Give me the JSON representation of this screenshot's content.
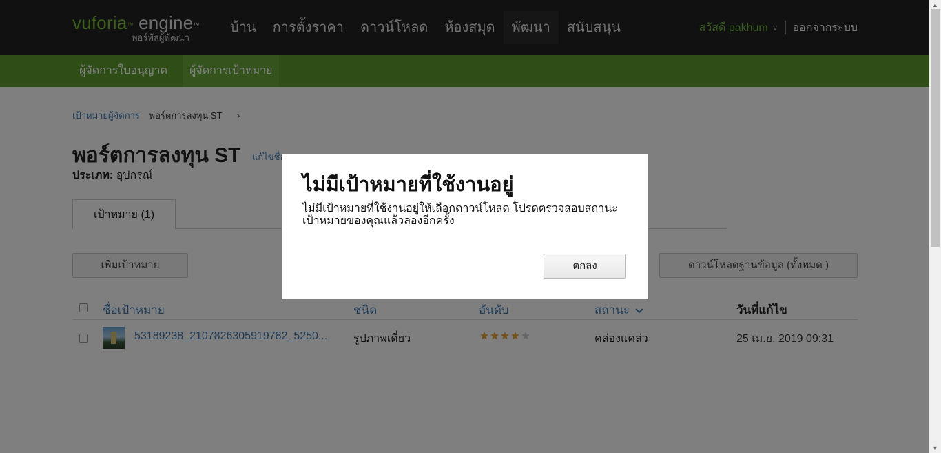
{
  "header": {
    "logo": {
      "brand": "vuforia",
      "product": "engine",
      "tm": "™",
      "subtitle": "พอร์ทัลผู้พัฒนา"
    },
    "nav": [
      {
        "label": "บ้าน"
      },
      {
        "label": "การตั้งราคา"
      },
      {
        "label": "ดาวน์โหลด"
      },
      {
        "label": "ห้องสมุด"
      },
      {
        "label": "พัฒนา",
        "active": true
      },
      {
        "label": "สนับสนุน"
      }
    ],
    "user": {
      "greeting": "สวัสดี pakhum",
      "chevron": "∨",
      "logout": "ออกจากระบบ"
    }
  },
  "subnav": [
    {
      "label": "ผู้จัดการใบอนุญาต"
    },
    {
      "label": "ผู้จัดการเป้าหมาย",
      "active": true
    }
  ],
  "breadcrumb": {
    "root": "เป้าหมายผู้จัดการ",
    "current": "พอร์ตการลงทุน ST",
    "separator": "›"
  },
  "database": {
    "title": "พอร์ตการลงทุน ST",
    "edit_label": "แก้ไขชื่อ",
    "type_label": "ประเภท:",
    "type_value": "อุปกรณ์"
  },
  "tabs": [
    {
      "label": "เป้าหมาย (1)"
    }
  ],
  "actions": {
    "add_target": "เพิ่มเป้าหมาย",
    "download_db": "ดาวน์โหลดฐานข้อมูล (ทั้งหมด )"
  },
  "table": {
    "headers": {
      "name": "ชื่อเป้าหมาย",
      "type": "ชนิด",
      "rating": "อันดับ",
      "status": "สถานะ",
      "status_sort_icon": "chevron-down-icon",
      "modified": "วันที่แก้ไข"
    },
    "rows": [
      {
        "name": "53189238_2107826305919782_5250...",
        "type": "รูปภาพเดี่ยว",
        "rating": 4,
        "rating_max": 5,
        "status": "คล่องแคล่ว",
        "modified": "25 เม.ย. 2019 09:31"
      }
    ]
  },
  "modal": {
    "title": "ไม่มีเป้าหมายที่ใช้งานอยู่",
    "body": "ไม่มีเป้าหมายที่ใช้งานอยู่ให้เลือกดาวน์โหลด โปรดตรวจสอบสถานะเป้าหมายของคุณแล้วลองอีกครั้ง",
    "ok_label": "ตกลง"
  },
  "colors": {
    "topbar": "#222222",
    "subbar": "#5c9a2e",
    "accent_green": "#6cb33f",
    "link_blue": "#3f7ab3",
    "star_filled": "#e8a33a",
    "star_empty": "#cccccc"
  }
}
